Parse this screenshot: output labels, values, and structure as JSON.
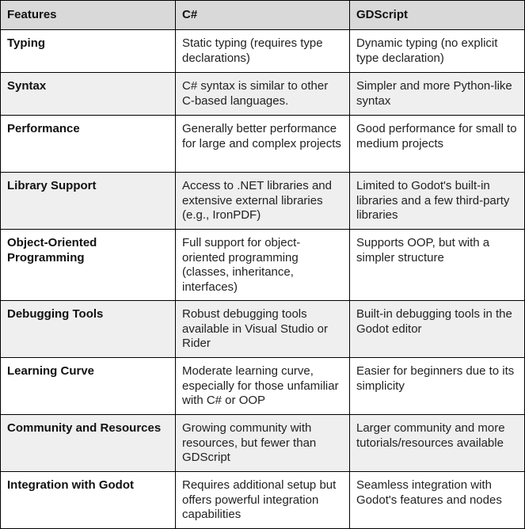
{
  "headers": [
    "Features",
    "C#",
    "GDScript"
  ],
  "rows": [
    {
      "feature": "Typing",
      "csharp": "Static typing (requires type declarations)",
      "gdscript": "Dynamic typing (no explicit type declaration)"
    },
    {
      "feature": "Syntax",
      "csharp": "C# syntax is similar to other C-based languages.",
      "gdscript": "Simpler and more Python-like syntax"
    },
    {
      "feature": "Performance",
      "csharp": "Generally better performance for large and complex projects",
      "gdscript": "Good performance for small to medium projects"
    },
    {
      "feature": "Library Support",
      "csharp": "Access to .NET libraries and extensive external libraries (e.g., IronPDF)",
      "gdscript": "Limited to Godot's built-in libraries and a few third-party libraries"
    },
    {
      "feature": "Object-Oriented Programming",
      "csharp": "Full support for object-oriented programming (classes, inheritance, interfaces)",
      "gdscript": "Supports OOP, but with a simpler structure"
    },
    {
      "feature": "Debugging Tools",
      "csharp": "Robust debugging tools available in Visual Studio or Rider",
      "gdscript": "Built-in debugging tools in the Godot editor"
    },
    {
      "feature": "Learning Curve",
      "csharp": "Moderate learning curve, especially for those unfamiliar with C# or OOP",
      "gdscript": "Easier for beginners due to its simplicity"
    },
    {
      "feature": "Community and Resources",
      "csharp": "Growing community with resources, but fewer than GDScript",
      "gdscript": "Larger community and more tutorials/resources available"
    },
    {
      "feature": "Integration with Godot",
      "csharp": "Requires additional setup but offers powerful integration capabilities",
      "gdscript": "Seamless integration with Godot's features and nodes"
    }
  ],
  "colors": {
    "header_bg": "#d9d9d9",
    "alt_row_bg": "#efefef",
    "border": "#000000"
  }
}
